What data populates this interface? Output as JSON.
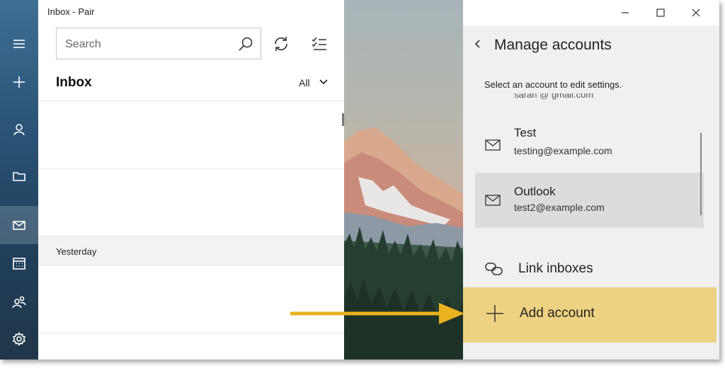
{
  "window": {
    "title": "Inbox - Pair"
  },
  "search": {
    "placeholder": "Search"
  },
  "inbox": {
    "heading": "Inbox",
    "filter": "All",
    "group_label": "Yesterday"
  },
  "app_bar": {
    "items": [
      "menu-icon",
      "new-mail-icon",
      "account-icon",
      "folder-icon",
      "mail-icon",
      "calendar-icon",
      "people-icon",
      "settings-icon"
    ],
    "active": "mail-icon"
  },
  "flyout": {
    "title": "Manage accounts",
    "subtitle": "Select an account to edit settings.",
    "cut_off_email": "sarah @ gmail.com",
    "accounts": [
      {
        "name": "Test",
        "email": "testing@example.com"
      },
      {
        "name": "Outlook",
        "email": "test2@example.com"
      }
    ],
    "link_inboxes": "Link inboxes",
    "add_account": "Add account"
  },
  "colors": {
    "add_account_highlight": "#ecd282",
    "arrow": "#eab21f",
    "app_bar": "#2b5477"
  }
}
